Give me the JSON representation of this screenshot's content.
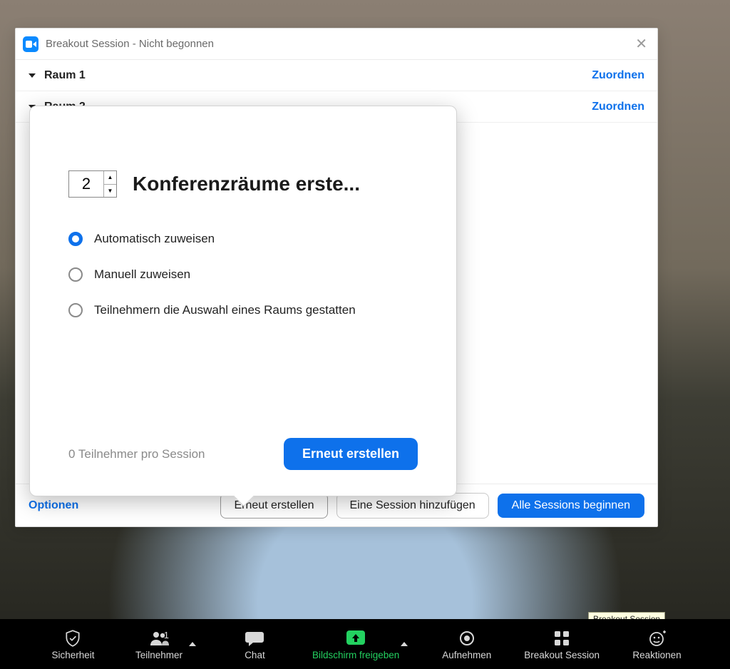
{
  "window": {
    "title": "Breakout Session - Nicht begonnen",
    "rooms": [
      {
        "name": "Raum 1",
        "assign_label": "Zuordnen"
      },
      {
        "name": "Raum 2",
        "assign_label": "Zuordnen"
      }
    ],
    "footer": {
      "options": "Optionen",
      "recreate": "Erneut erstellen",
      "add_session": "Eine Session hinzufügen",
      "start_all": "Alle Sessions beginnen"
    }
  },
  "popover": {
    "room_count": "2",
    "heading": "Konferenzräume erste...",
    "options": {
      "auto": "Automatisch zuweisen",
      "manual": "Manuell zuweisen",
      "choose": "Teilnehmern die Auswahl eines Raums gestatten"
    },
    "selected": "auto",
    "participants_per_session": "0 Teilnehmer pro Session",
    "recreate_button": "Erneut erstellen"
  },
  "tooltip": "Breakout Session",
  "controlbar": {
    "security": "Sicherheit",
    "participants": "Teilnehmer",
    "participants_count": "1",
    "chat": "Chat",
    "share": "Bildschirm freigeben",
    "record": "Aufnehmen",
    "breakout": "Breakout Session",
    "reactions": "Reaktionen"
  },
  "colors": {
    "accent": "#0e71eb",
    "green": "#23d160"
  }
}
